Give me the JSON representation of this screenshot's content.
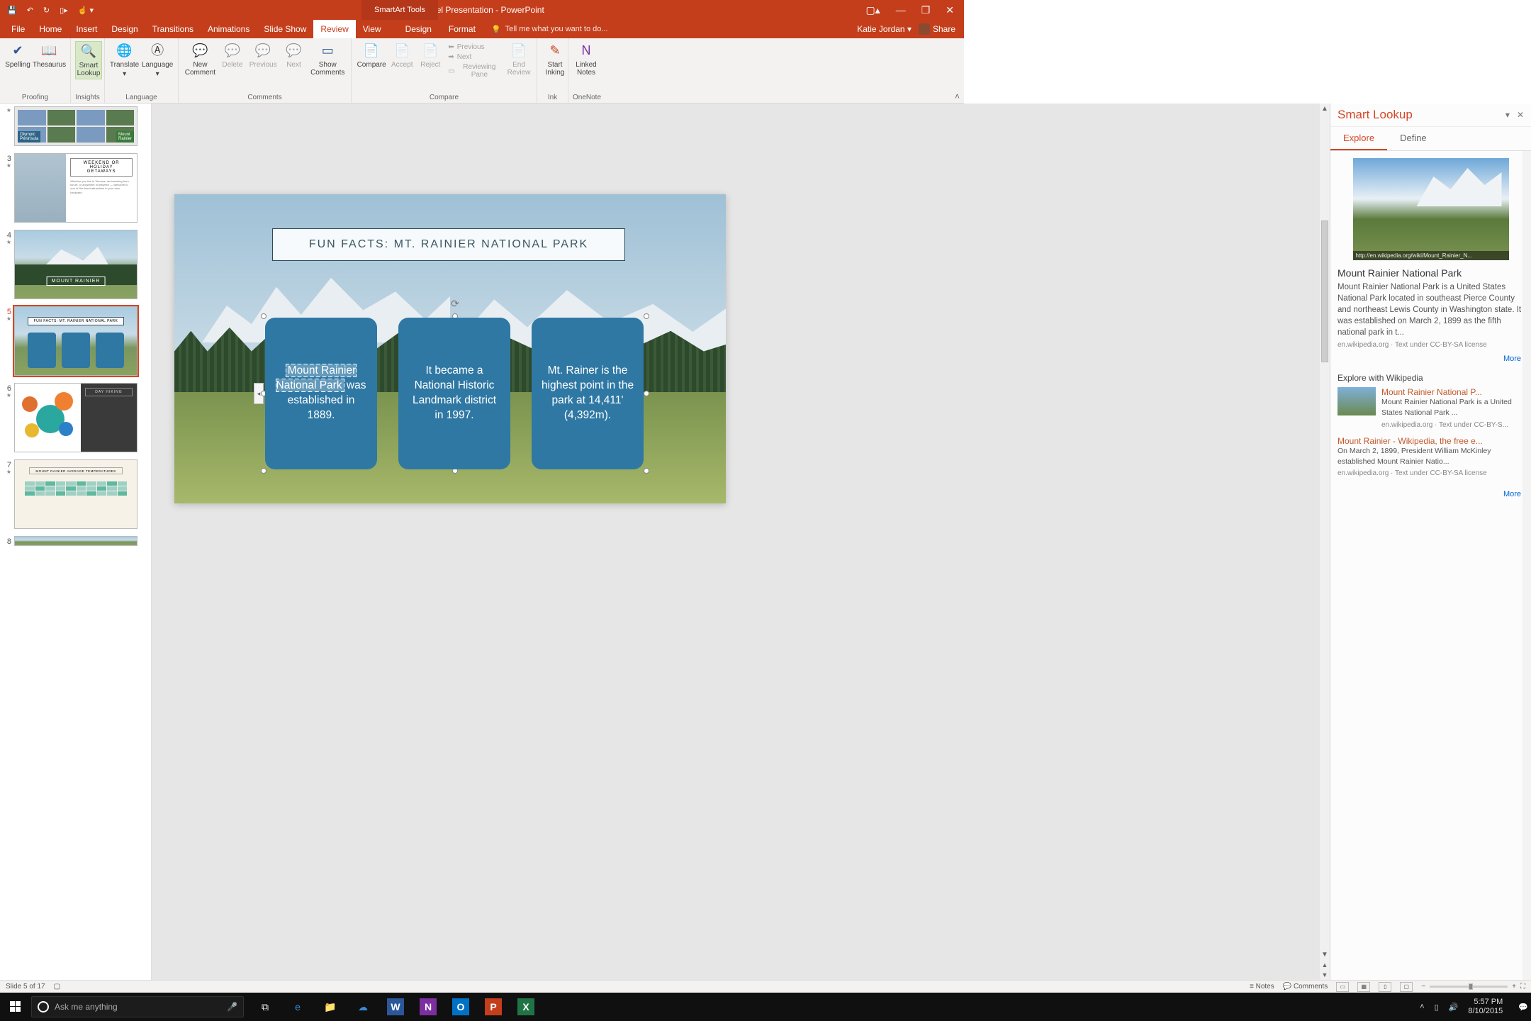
{
  "titlebar": {
    "title": "Travel Presentation - PowerPoint",
    "contextual_label": "SmartArt Tools"
  },
  "user": {
    "name": "Katie Jordan",
    "share": "Share"
  },
  "tabs": {
    "items": [
      "File",
      "Home",
      "Insert",
      "Design",
      "Transitions",
      "Animations",
      "Slide Show",
      "Review",
      "View"
    ],
    "active": "Review",
    "contextual": [
      "Design",
      "Format"
    ],
    "tellme": "Tell me what you want to do..."
  },
  "ribbon": {
    "groups": {
      "proofing": {
        "label": "Proofing",
        "spelling": "Spelling",
        "thesaurus": "Thesaurus"
      },
      "insights": {
        "label": "Insights",
        "smart_lookup": "Smart\nLookup"
      },
      "language": {
        "label": "Language",
        "translate": "Translate",
        "language": "Language"
      },
      "comments": {
        "label": "Comments",
        "new_comment": "New\nComment",
        "delete": "Delete",
        "previous": "Previous",
        "next": "Next",
        "show": "Show\nComments"
      },
      "compare": {
        "label": "Compare",
        "compare": "Compare",
        "accept": "Accept",
        "reject": "Reject",
        "prev": "Previous",
        "nxt": "Next",
        "pane": "Reviewing Pane",
        "end": "End\nReview"
      },
      "ink": {
        "label": "Ink",
        "start": "Start\nInking"
      },
      "onenote": {
        "label": "OneNote",
        "linked": "Linked\nNotes"
      }
    }
  },
  "thumbs": {
    "visible": [
      {
        "num": "",
        "kind": "partial_grid"
      },
      {
        "num": "3",
        "kind": "white_text",
        "title": "WEEKEND OR\nHOLIDAY\nGETAWAYS"
      },
      {
        "num": "4",
        "kind": "mountain",
        "title": "MOUNT RAINIER"
      },
      {
        "num": "5",
        "kind": "facts",
        "title": "FUN FACTS: MT. RAINIER NATIONAL PARK",
        "selected": true
      },
      {
        "num": "6",
        "kind": "bubbles",
        "title": "DAY HIKING"
      },
      {
        "num": "7",
        "kind": "table",
        "title": "MOUNT RAINIER AVERAGE TEMPERATURES"
      },
      {
        "num": "8",
        "kind": "partial"
      }
    ]
  },
  "slide": {
    "title": "FUN FACTS: MT. RAINIER NATIONAL PARK",
    "cards": [
      {
        "highlight": "Mount Rainier National Park",
        "rest": " was  established in 1889."
      },
      {
        "text": "It became a National Historic Landmark district in 1997."
      },
      {
        "text": "Mt. Rainer is the highest point in the park at 14,411' (4,392m)."
      }
    ]
  },
  "pane": {
    "title": "Smart Lookup",
    "tabs": {
      "explore": "Explore",
      "define": "Define",
      "active": "Explore"
    },
    "primary": {
      "img_caption": "http://en.wikipedia.org/wiki/Mount_Rainier_N...",
      "heading": "Mount Rainier National Park",
      "desc": "Mount Rainier National Park is a United States National Park located in southeast Pierce County and northeast Lewis County in Washington state. It was established on March 2, 1899 as the fifth national park in t...",
      "meta": "en.wikipedia.org  ·  Text under CC-BY-SA license"
    },
    "more": "More",
    "section": "Explore with Wikipedia",
    "wiki": [
      {
        "link": "Mount Rainier National P...",
        "desc": "Mount Rainier National Park is a United States National Park ...",
        "meta": "en.wikipedia.org · Text under CC-BY-S..."
      },
      {
        "link": "Mount Rainier - Wikipedia, the free e...",
        "desc": "On March 2, 1899, President William McKinley established Mount Rainier Natio...",
        "meta": "en.wikipedia.org · Text under CC-BY-SA license"
      }
    ]
  },
  "statusbar": {
    "slide": "Slide 5 of 17",
    "notes": "Notes",
    "comments": "Comments"
  },
  "taskbar": {
    "search_placeholder": "Ask me anything",
    "time": "5:57 PM",
    "date": "8/10/2015"
  }
}
